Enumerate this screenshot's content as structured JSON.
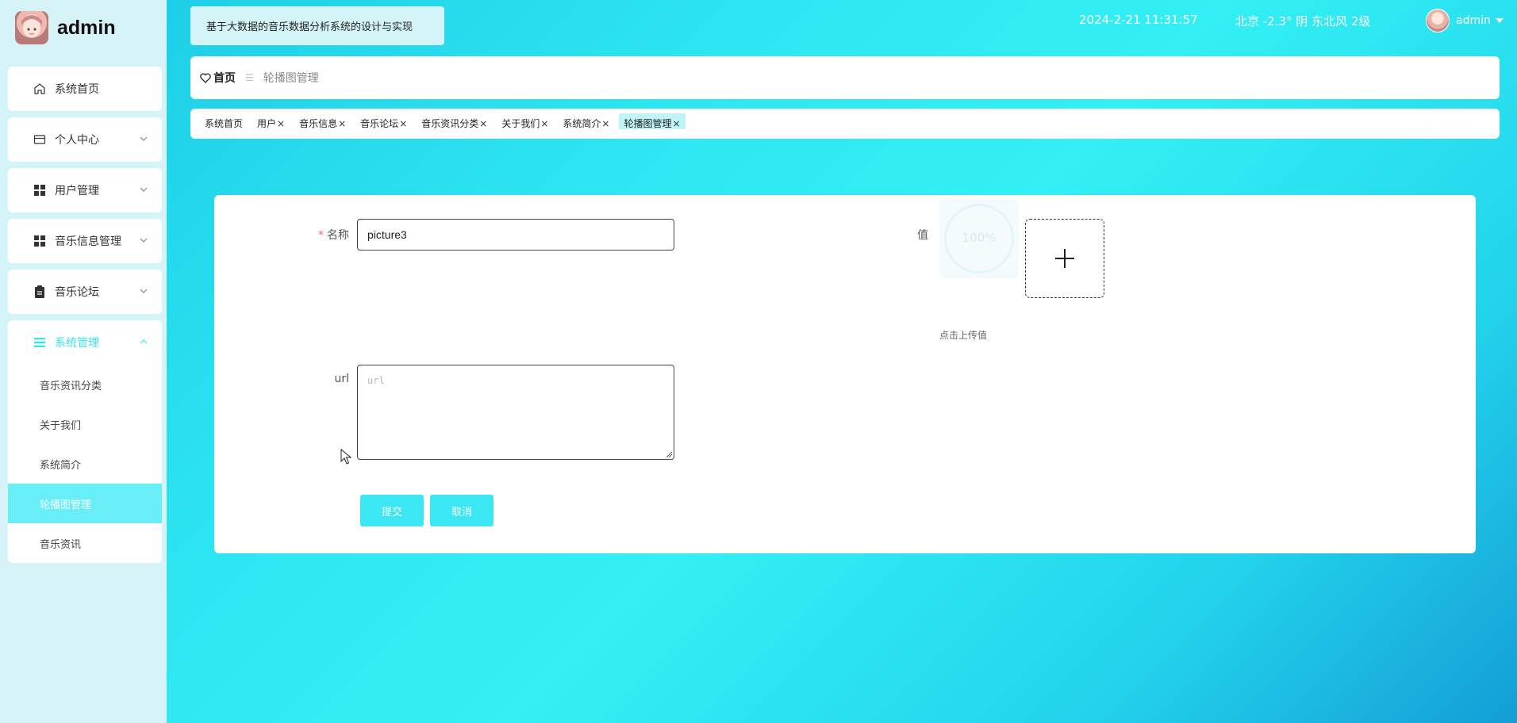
{
  "sidebar": {
    "brand": "admin",
    "menu": [
      {
        "label": "系统首页",
        "icon": "home-icon"
      },
      {
        "label": "个人中心",
        "icon": "card-icon"
      },
      {
        "label": "用户管理",
        "icon": "grid-icon"
      },
      {
        "label": "音乐信息管理",
        "icon": "grid-icon"
      },
      {
        "label": "音乐论坛",
        "icon": "clipboard-icon"
      },
      {
        "label": "系统管理",
        "icon": "list-icon"
      }
    ],
    "submenu": [
      "音乐资讯分类",
      "关于我们",
      "系统简介",
      "轮播图管理",
      "音乐资讯"
    ],
    "active_submenu": "轮播图管理"
  },
  "header": {
    "site_title": "基于大数据的音乐数据分析系统的设计与实现",
    "datetime": "2024-2-21 11:31:57",
    "weather": "北京  -2.3°  阴  东北风  2级",
    "username": "admin"
  },
  "breadcrumb": {
    "home": "首页",
    "current": "轮播图管理"
  },
  "tags": [
    {
      "label": "系统首页",
      "closable": false
    },
    {
      "label": "用户",
      "closable": true
    },
    {
      "label": "音乐信息",
      "closable": true
    },
    {
      "label": "音乐论坛",
      "closable": true
    },
    {
      "label": "音乐资讯分类",
      "closable": true
    },
    {
      "label": "关于我们",
      "closable": true
    },
    {
      "label": "系统简介",
      "closable": true
    },
    {
      "label": "轮播图管理",
      "closable": true,
      "active": true
    }
  ],
  "form": {
    "name_label": "名称",
    "name_value": "picture3",
    "value_label": "值",
    "upload_progress": "100%",
    "upload_tip": "点击上传值",
    "url_label": "url",
    "url_placeholder": "url",
    "url_value": "",
    "submit": "提交",
    "cancel": "取消"
  },
  "colors": {
    "accent": "#3ae7f2",
    "sidebar_bg": "#d6f4f8",
    "required": "#f56c6c"
  }
}
